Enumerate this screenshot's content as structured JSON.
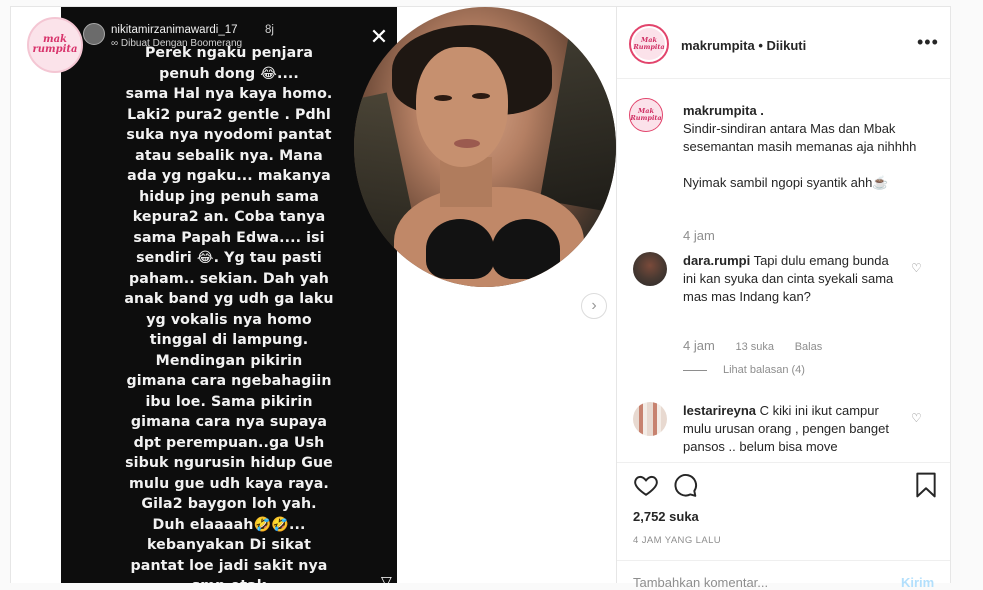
{
  "story": {
    "username": "nikitamirzanimawardi_17",
    "time": "8j",
    "subline": "∞ Dibuat Dengan Boomerang",
    "close_glyph": "✕",
    "send_glyph": "▽",
    "lines": [
      "Perek ngaku penjara",
      "penuh dong 😂....",
      "sama Hal nya kaya homo.",
      "Laki2 pura2 gentle . Pdhl",
      "suka nya nyodomi pantat",
      "atau sebalik nya. Mana",
      "ada yg ngaku... makanya",
      "hidup jng penuh sama",
      "kepura2 an. Coba tanya",
      "sama Papah Edwa.... isi",
      "sendiri 😂. Yg tau pasti",
      "paham.. sekian. Dah yah",
      "anak band yg udh ga laku",
      "yg vokalis nya homo",
      "tinggal di lampung.",
      "Mendingan pikirin",
      "gimana cara ngebahagiin",
      "ibu loe. Sama pikirin",
      "gimana cara nya supaya",
      "dpt perempuan..ga Ush",
      "sibuk ngurusin hidup Gue",
      "mulu gue udh kaya raya.",
      "Gila2 baygon loh yah.",
      "Duh elaaaah🤣🤣...",
      "kebanyakan Di sikat",
      "pantat loe jadi sakit nya",
      "smp otak"
    ]
  },
  "media": {
    "next_glyph": "›"
  },
  "header": {
    "account": "makrumpita",
    "separator": " • ",
    "follow_status": "Diikuti",
    "more_glyph": "•••",
    "avatar_text": "Mak Rumpita"
  },
  "caption": {
    "username": "makrumpita .",
    "text1": "Sindir-sindiran antara Mas dan Mbak sesemantan masih memanas aja nihhhh",
    "text2": "Nyimak sambil ngopi syantik ahh☕",
    "time": "4 jam"
  },
  "comments": [
    {
      "username": "dara.rumpi",
      "text": "Tapi dulu emang bunda ini kan syuka dan cinta syekali sama mas mas Indang kan?",
      "time": "4 jam",
      "likes": "13 suka",
      "reply_label": "Balas",
      "view_replies": "Lihat balasan (4)",
      "like_glyph": "♡"
    },
    {
      "username": "lestarireyna",
      "text": "C kiki ini ikut campur mulu urusan orang , pengen banget pansos .. belum bisa move",
      "like_glyph": "♡"
    }
  ],
  "actions": {
    "likes_count": "2,752 suka",
    "timestamp": "4 JAM YANG LALU",
    "comment_placeholder": "Tambahkan komentar...",
    "post_label": "Kirim"
  }
}
